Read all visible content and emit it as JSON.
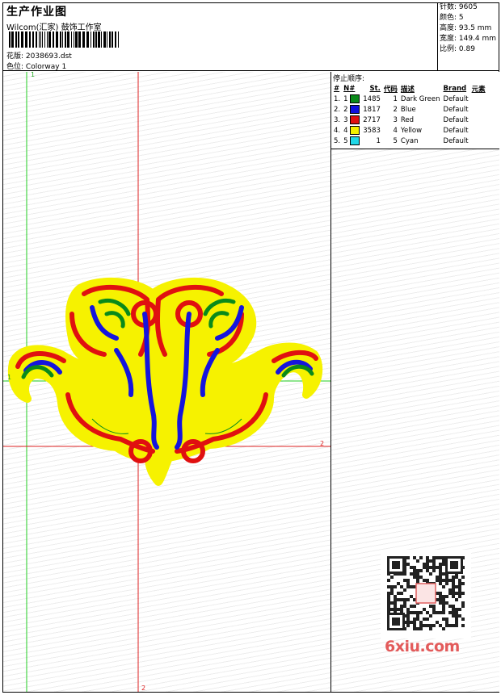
{
  "header": {
    "title": "生产作业图",
    "studio": "Wilcom(汇家) 鼓饰工作室",
    "design_label": "花版:",
    "design_value": "2038693.dst",
    "colorway_label": "色位:",
    "colorway_value": "Colorway 1"
  },
  "stats": {
    "stitches": "针数: 9605",
    "colors": "颜色: 5",
    "height": "高度: 93.5 mm",
    "width": "宽度: 149.4 mm",
    "scale": "比例: 0.89"
  },
  "stop_sequence": {
    "title": "停止顺序:",
    "headers": [
      "#",
      "N#",
      "St.",
      "代码",
      "描述",
      "Brand",
      "元素"
    ],
    "rows": [
      {
        "idx": "1.",
        "n": "1",
        "color": "#0a8a1a",
        "st": "1485",
        "code": "1",
        "desc": "Dark Green",
        "brand": "Default"
      },
      {
        "idx": "2.",
        "n": "2",
        "color": "#1010dd",
        "st": "1817",
        "code": "2",
        "desc": "Blue",
        "brand": "Default"
      },
      {
        "idx": "3.",
        "n": "3",
        "color": "#e01010",
        "st": "2717",
        "code": "3",
        "desc": "Red",
        "brand": "Default"
      },
      {
        "idx": "4.",
        "n": "4",
        "color": "#f4f000",
        "st": "3583",
        "code": "4",
        "desc": "Yellow",
        "brand": "Default"
      },
      {
        "idx": "5.",
        "n": "5",
        "color": "#20d8e8",
        "st": "1",
        "code": "5",
        "desc": "Cyan",
        "brand": "Default"
      }
    ]
  },
  "guides": {
    "green_v_label": "1",
    "green_h_label": "1",
    "red_h_label": "2",
    "red_v_label": "2"
  },
  "watermark": "6xiu.com"
}
